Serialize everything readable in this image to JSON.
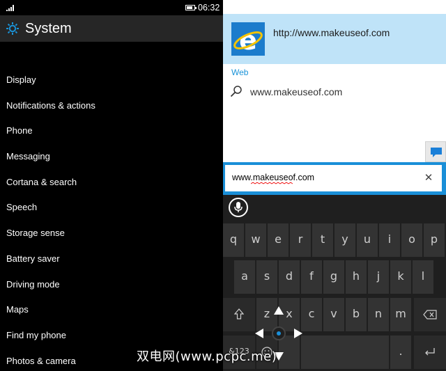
{
  "left": {
    "status": {
      "time": "06:32"
    },
    "header": {
      "title": "System"
    },
    "menu": [
      "Display",
      "Notifications & actions",
      "Phone",
      "Messaging",
      "Cortana & search",
      "Speech",
      "Storage sense",
      "Battery saver",
      "Driving mode",
      "Maps",
      "Find my phone",
      "Photos & camera"
    ]
  },
  "right": {
    "suggestion": {
      "url": "http://www.makeuseof.com",
      "icon": "internet-explorer-icon"
    },
    "web": {
      "label": "Web",
      "query": "www.makeuseof.com"
    },
    "address": {
      "value": "www.makeuseof.com"
    },
    "keyboard": {
      "row1": [
        "q",
        "w",
        "e",
        "r",
        "t",
        "y",
        "u",
        "i",
        "o",
        "p"
      ],
      "row2": [
        "a",
        "s",
        "d",
        "f",
        "g",
        "h",
        "j",
        "k",
        "l"
      ],
      "row3": [
        "z",
        "x",
        "c",
        "v",
        "b",
        "n",
        "m"
      ],
      "symbols_key": "&123",
      "dot_key": "."
    }
  },
  "watermark": "双电网(www.pcpc.me)",
  "colors": {
    "accent": "#1a8fd8",
    "suggestion_bg": "#bfe3f8",
    "keyboard_bg": "#1f1f1f",
    "key_bg": "#333333"
  }
}
